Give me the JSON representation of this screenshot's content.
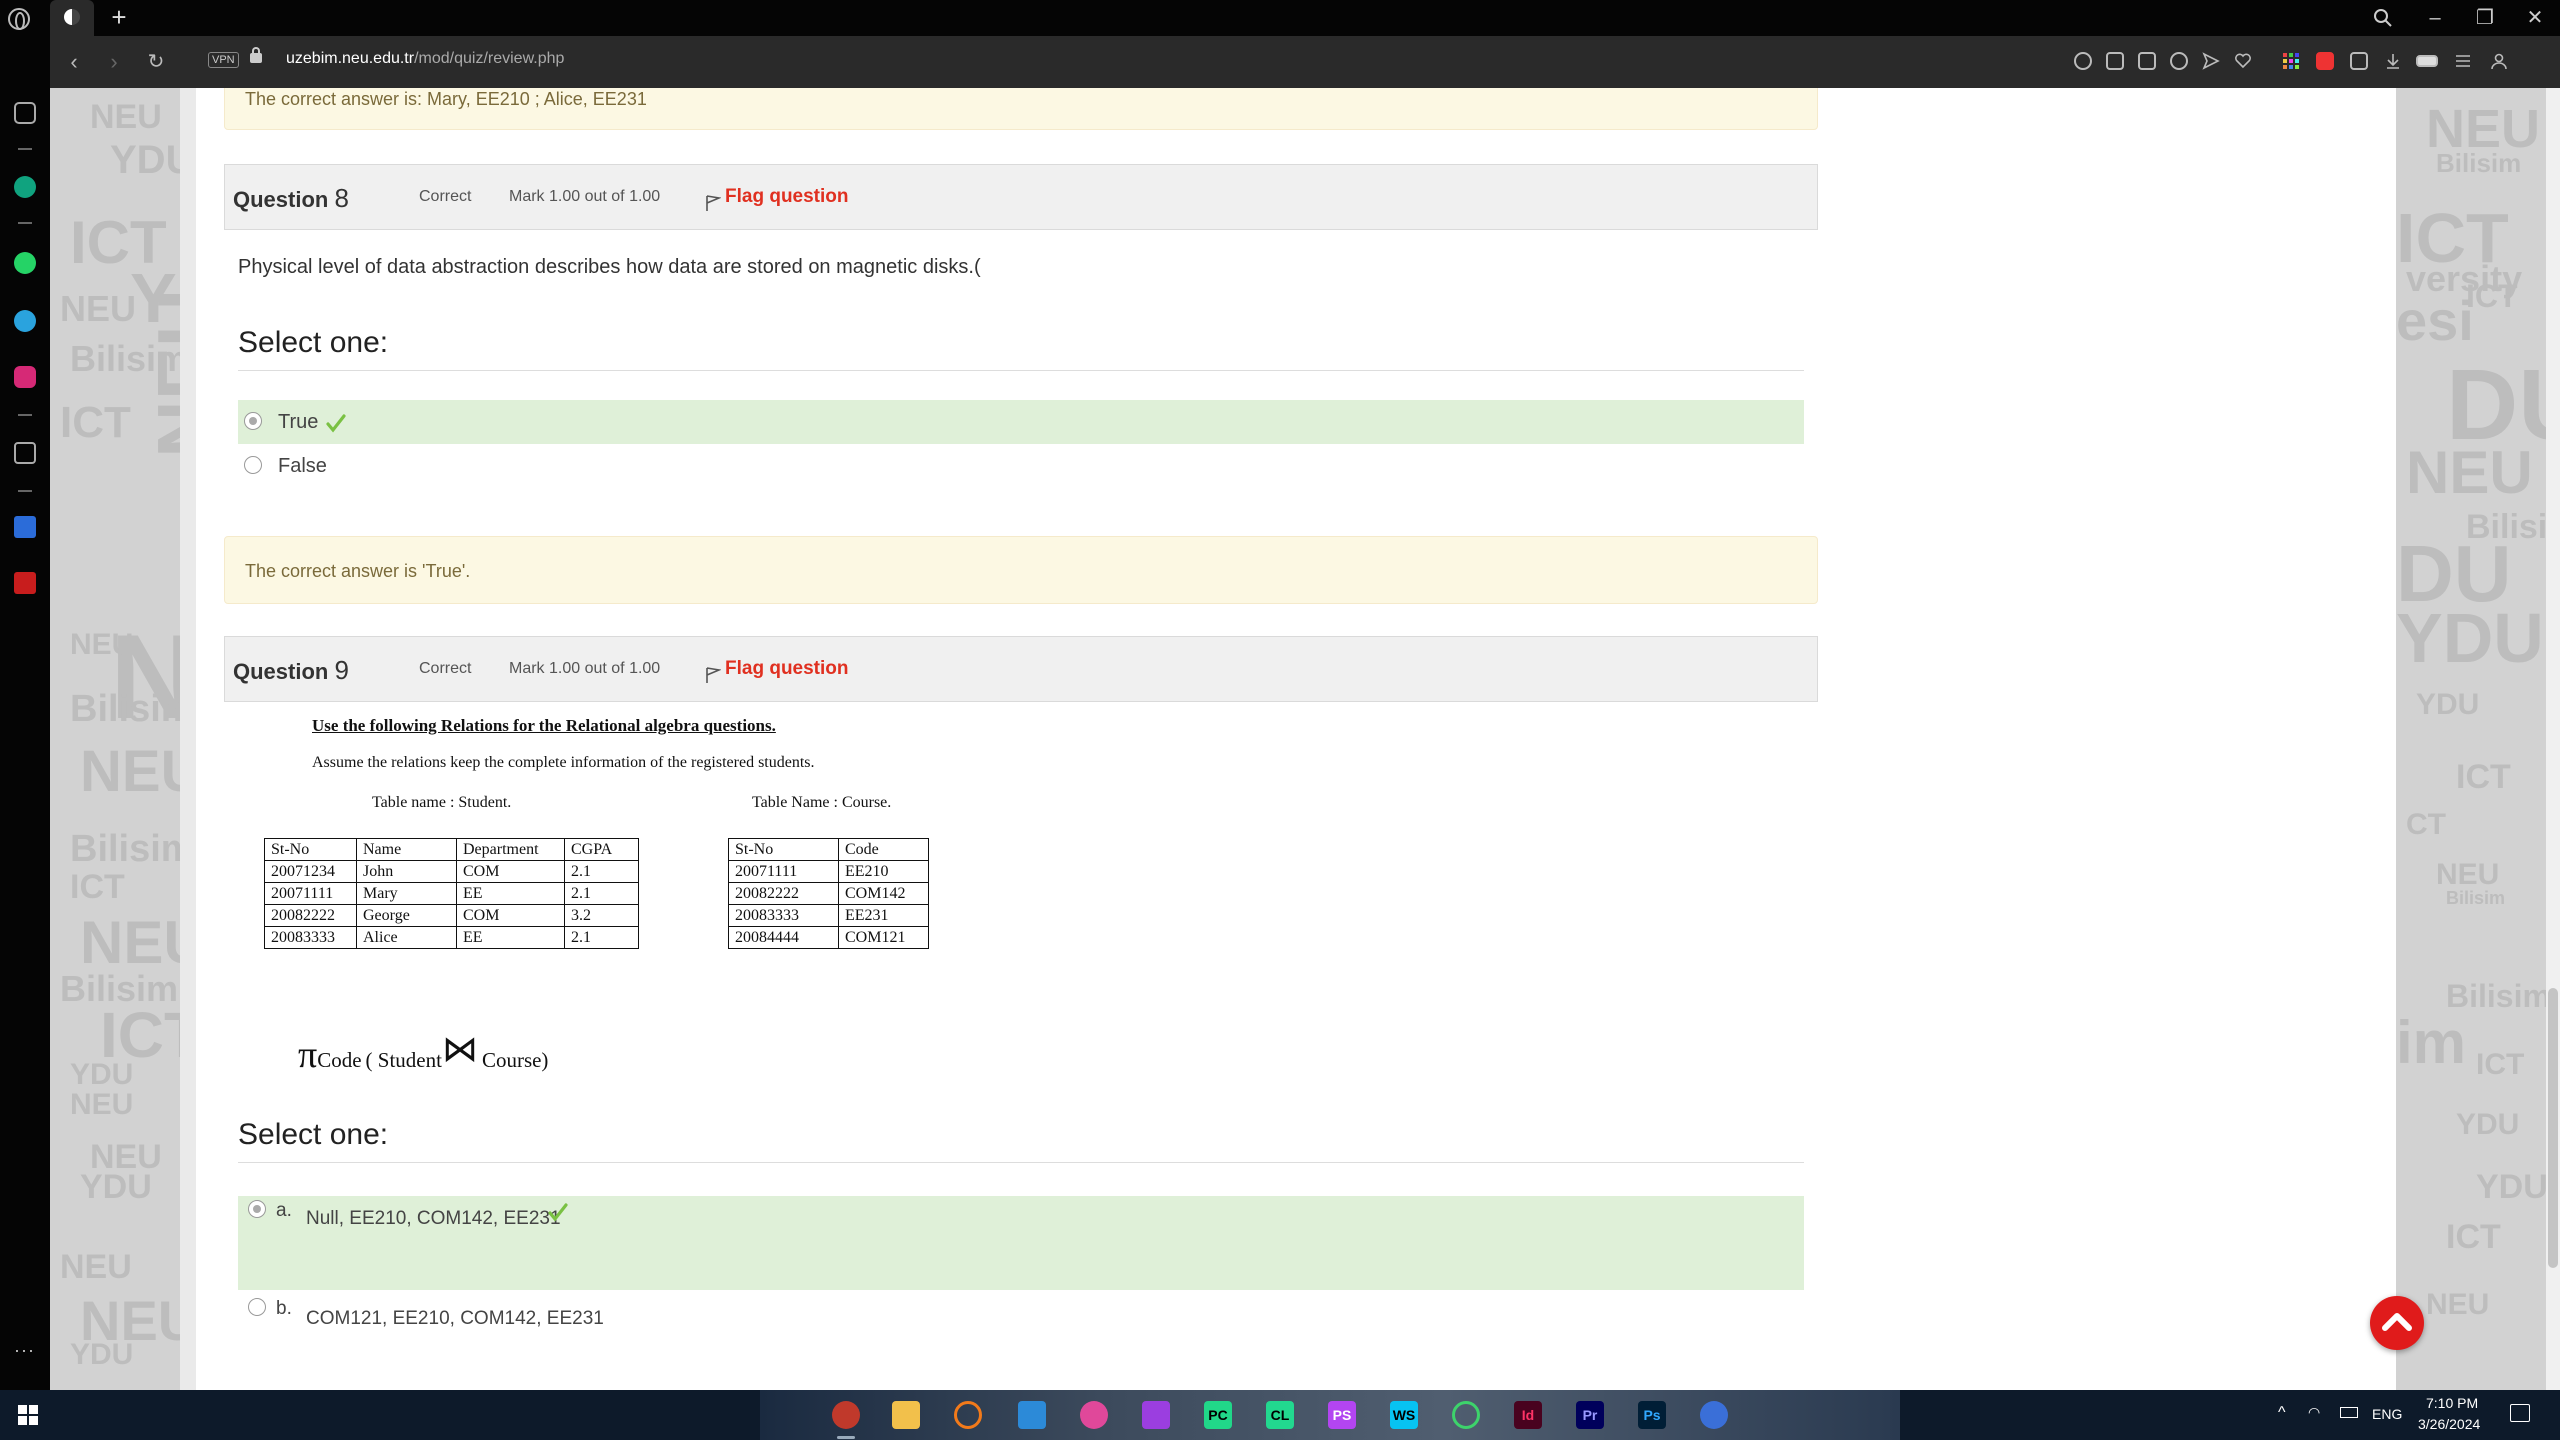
{
  "browser": {
    "url_host": "uzebim.neu.edu.tr",
    "url_path": "/mod/quiz/review.php",
    "vpn_label": "VPN"
  },
  "page": {
    "prev_feedback": "The correct answer is: Mary, EE210 ; Alice, EE231",
    "questions": [
      {
        "label": "Question",
        "number": "8",
        "state": "Correct",
        "grade": "Mark 1.00 out of 1.00",
        "flag": "Flag question",
        "text": "Physical level of data abstraction describes how data are stored on magnetic disks.(",
        "select_one": "Select one:",
        "answers": [
          {
            "text": "True",
            "selected": true,
            "correct": true
          },
          {
            "text": "False",
            "selected": false,
            "correct": false
          }
        ],
        "feedback": "The correct answer is 'True'."
      },
      {
        "label": "Question",
        "number": "9",
        "state": "Correct",
        "grade": "Mark 1.00 out of 1.00",
        "flag": "Flag question",
        "image": {
          "heading": "Use the following Relations for the Relational algebra questions.",
          "assumption": "Assume the relations keep the complete information of the registered students.",
          "student_table_name": "Table name : Student.",
          "course_table_name": "Table Name : Course.",
          "student_table": {
            "header": [
              "St-No",
              "Name",
              "Department",
              "CGPA"
            ],
            "rows": [
              [
                "20071234",
                "John",
                "COM",
                "2.1"
              ],
              [
                "20071111",
                "Mary",
                "EE",
                "2.1"
              ],
              [
                "20082222",
                "George",
                "COM",
                "3.2"
              ],
              [
                "20083333",
                "Alice",
                "EE",
                "2.1"
              ]
            ]
          },
          "course_table": {
            "header": [
              "St-No",
              "Code"
            ],
            "rows": [
              [
                "20071111",
                "EE210"
              ],
              [
                "20082222",
                "COM142"
              ],
              [
                "20083333",
                "EE231"
              ],
              [
                "20084444",
                "COM121"
              ]
            ]
          },
          "formula": {
            "pi": "π",
            "subscript": "Code",
            "open": "( Student",
            "join": "⋈",
            "close": "Course)"
          }
        },
        "select_one": "Select one:",
        "answers": [
          {
            "letter": "a.",
            "text": "Null, EE210, COM142, EE231",
            "selected": true,
            "correct": true
          },
          {
            "letter": "b.",
            "text": "COM121, EE210, COM142, EE231",
            "selected": false,
            "correct": false
          }
        ]
      }
    ]
  },
  "taskbar": {
    "lang": "ENG",
    "time": "7:10 PM",
    "date": "3/26/2024"
  },
  "colors": {
    "correct_bg": "#dff0d8",
    "feedback_bg": "#fcf8e3",
    "flag_red": "#e03020",
    "tick_green": "#7ac143"
  }
}
